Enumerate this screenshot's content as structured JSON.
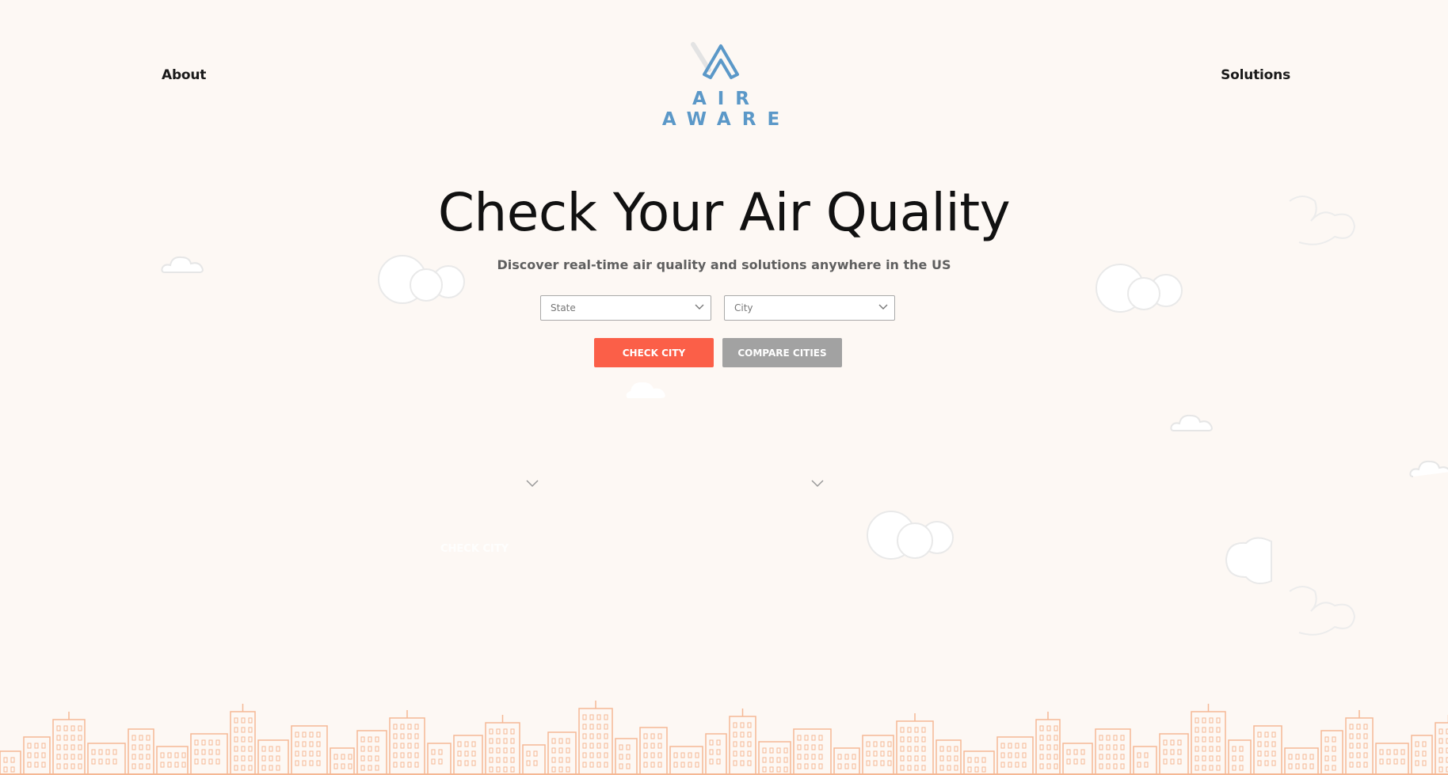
{
  "nav": {
    "about": "About",
    "solutions": "Solutions"
  },
  "brand": {
    "name": "AIR AWARE",
    "color": "#5b98c8"
  },
  "hero": {
    "title": "Check Your Air Quality",
    "subtitle": "Discover real-time air quality and solutions anywhere in the US"
  },
  "form": {
    "state_placeholder": "State",
    "city_placeholder": "City",
    "check_button": "CHECK CITY",
    "compare_button": "COMPARE CITIES"
  },
  "colors": {
    "accent": "#fb5f48",
    "secondary": "#a2a2a2",
    "skyline": "#f5b895",
    "background": "#fdf8f4"
  },
  "icons": {
    "chevron": "chevron-down-icon",
    "cloud": "cloud-icon",
    "skyline": "city-skyline-illustration"
  }
}
